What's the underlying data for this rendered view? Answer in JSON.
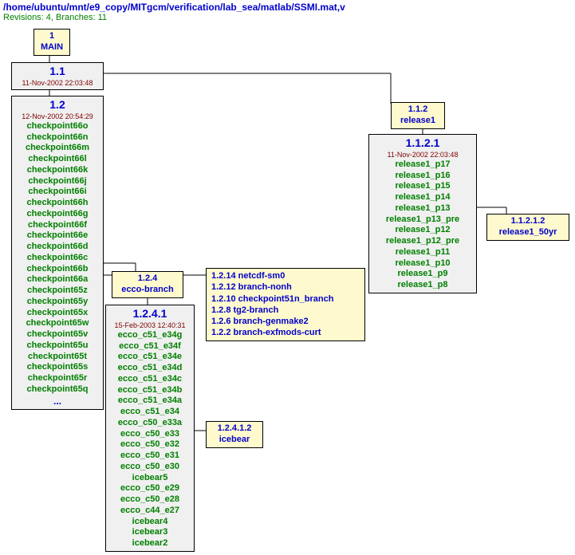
{
  "header": {
    "path": "/home/ubuntu/mnt/e9_copy/MITgcm/verification/lab_sea/matlab/SSMI.mat,v",
    "stats": "Revisions: 4, Branches: 11"
  },
  "main": {
    "num": "1",
    "label": "MAIN"
  },
  "r11": {
    "num": "1.1",
    "date": "11-Nov-2002 22:03:48"
  },
  "r12": {
    "num": "1.2",
    "date": "12-Nov-2002 20:54:29",
    "tags": [
      "checkpoint66o",
      "checkpoint66n",
      "checkpoint66m",
      "checkpoint66l",
      "checkpoint66k",
      "checkpoint66j",
      "checkpoint66i",
      "checkpoint66h",
      "checkpoint66g",
      "checkpoint66f",
      "checkpoint66e",
      "checkpoint66d",
      "checkpoint66c",
      "checkpoint66b",
      "checkpoint66a",
      "checkpoint65z",
      "checkpoint65y",
      "checkpoint65x",
      "checkpoint65w",
      "checkpoint65v",
      "checkpoint65u",
      "checkpoint65t",
      "checkpoint65s",
      "checkpoint65r",
      "checkpoint65q"
    ],
    "ellipsis": "..."
  },
  "ecco": {
    "num": "1.2.4",
    "label": "ecco-branch",
    "rev": {
      "num": "1.2.4.1",
      "date": "15-Feb-2003 12:40:31"
    },
    "tags": [
      "ecco_c51_e34g",
      "ecco_c51_e34f",
      "ecco_c51_e34e",
      "ecco_c51_e34d",
      "ecco_c51_e34c",
      "ecco_c51_e34b",
      "ecco_c51_e34a",
      "ecco_c51_e34",
      "ecco_c50_e33a",
      "ecco_c50_e33",
      "ecco_c50_e32",
      "ecco_c50_e31",
      "ecco_c50_e30",
      "icebear5",
      "ecco_c50_e29",
      "ecco_c50_e28",
      "ecco_c44_e27",
      "icebear4",
      "icebear3",
      "icebear2"
    ]
  },
  "sidebranches": [
    "1.2.14 netcdf-sm0",
    "1.2.12 branch-nonh",
    "1.2.10 checkpoint51n_branch",
    "1.2.8 tg2-branch",
    "1.2.6 branch-genmake2",
    "1.2.2 branch-exfmods-curt"
  ],
  "icebear": {
    "num": "1.2.4.1.2",
    "label": "icebear"
  },
  "release1": {
    "num": "1.1.2",
    "label": "release1",
    "rev": {
      "num": "1.1.2.1",
      "date": "11-Nov-2002 22:03:48"
    },
    "tags": [
      "release1_p17",
      "release1_p16",
      "release1_p15",
      "release1_p14",
      "release1_p13",
      "release1_p13_pre",
      "release1_p12",
      "release1_p12_pre",
      "release1_p11",
      "release1_p10",
      "release1_p9",
      "release1_p8"
    ]
  },
  "r50yr": {
    "num": "1.1.2.1.2",
    "label": "release1_50yr"
  }
}
